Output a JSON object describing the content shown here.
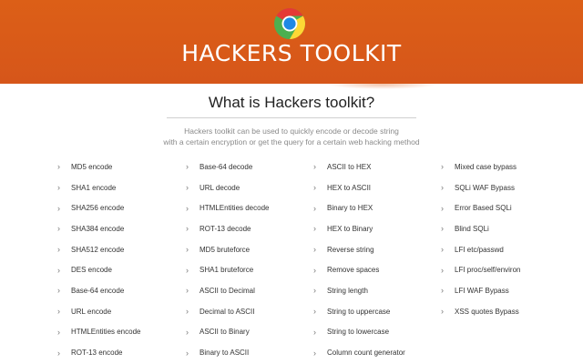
{
  "header": {
    "brand": "HACKERS TOOLKIT",
    "logo_icon": "chrome-icon",
    "background_color": "#d95a14"
  },
  "main": {
    "heading": "What is Hackers toolkit?",
    "description_lines": [
      "Hackers toolkit can be used to quickly encode or decode string",
      "with a certain encryption or get the query for a certain web hacking method"
    ]
  },
  "columns": [
    {
      "items": [
        "MD5 encode",
        "SHA1 encode",
        "SHA256 encode",
        "SHA384 encode",
        "SHA512 encode",
        "DES encode",
        "Base-64 encode",
        "URL encode",
        "HTMLEntities encode",
        "ROT-13 encode"
      ]
    },
    {
      "items": [
        "Base-64 decode",
        "URL decode",
        "HTMLEntities decode",
        "ROT-13 decode",
        "MD5 bruteforce",
        "SHA1 bruteforce",
        "ASCII to Decimal",
        "Decimal to ASCII",
        "ASCII to Binary",
        "Binary to ASCII"
      ]
    },
    {
      "items": [
        "ASCII to HEX",
        "HEX to ASCII",
        "Binary to HEX",
        "HEX to Binary",
        "Reverse string",
        "Remove spaces",
        "String length",
        "String to uppercase",
        "String to lowercase",
        "Column count generator"
      ]
    },
    {
      "items": [
        "Mixed case bypass",
        "SQLi WAF Bypass",
        "Error Based SQLi",
        "Blind SQLi",
        "LFI etc/passwd",
        "LFI proc/self/environ",
        "LFI WAF Bypass",
        "XSS quotes Bypass"
      ]
    }
  ],
  "bullet_icon": "chevron-right-icon"
}
